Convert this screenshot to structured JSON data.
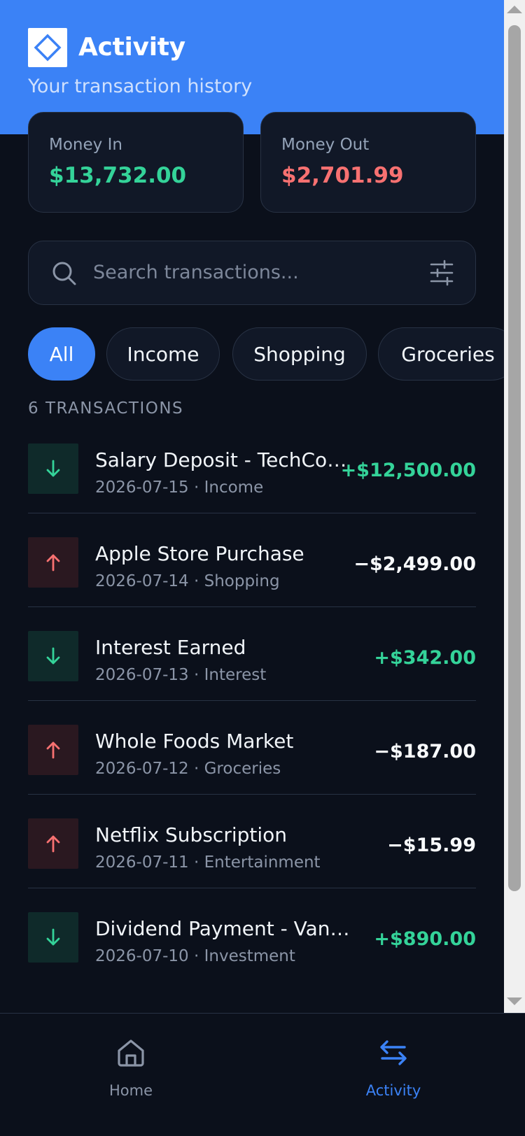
{
  "header": {
    "title": "Activity",
    "subtitle": "Your transaction history",
    "logo_icon": "diamond-logo-icon",
    "background": "#3b82f6"
  },
  "summary": {
    "money_in": {
      "label": "Money In",
      "value": "$13,732.00",
      "color": "#34d399"
    },
    "money_out": {
      "label": "Money Out",
      "value": "$2,701.99",
      "color": "#f87171"
    }
  },
  "search": {
    "placeholder": "Search transactions...",
    "value": "",
    "icon": "search-icon",
    "filter_icon": "sliders-icon"
  },
  "filters": [
    {
      "label": "All",
      "active": true
    },
    {
      "label": "Income",
      "active": false
    },
    {
      "label": "Shopping",
      "active": false
    },
    {
      "label": "Groceries",
      "active": false
    }
  ],
  "transactions_count": "6 TRANSACTIONS",
  "transactions": [
    {
      "name": "Salary Deposit - TechCorp Inc.",
      "meta": "2026-07-15 · Income",
      "amount": "+$12,500.00",
      "type": "credit",
      "icon": "arrow-down-icon"
    },
    {
      "name": "Apple Store Purchase",
      "meta": "2026-07-14 · Shopping",
      "amount": "−$2,499.00",
      "type": "debit",
      "icon": "arrow-up-icon"
    },
    {
      "name": "Interest Earned",
      "meta": "2026-07-13 · Interest",
      "amount": "+$342.00",
      "type": "credit",
      "icon": "arrow-down-icon"
    },
    {
      "name": "Whole Foods Market",
      "meta": "2026-07-12 · Groceries",
      "amount": "−$187.00",
      "type": "debit",
      "icon": "arrow-up-icon"
    },
    {
      "name": "Netflix Subscription",
      "meta": "2026-07-11 · Entertainment",
      "amount": "−$15.99",
      "type": "debit",
      "icon": "arrow-up-icon"
    },
    {
      "name": "Dividend Payment - Vanguard",
      "meta": "2026-07-10 · Investment",
      "amount": "+$890.00",
      "type": "credit",
      "icon": "arrow-down-icon"
    }
  ],
  "nav": {
    "home": {
      "label": "Home",
      "icon": "home-icon"
    },
    "activity": {
      "label": "Activity",
      "icon": "transfer-arrows-icon",
      "active": true
    }
  },
  "colors": {
    "accent": "#3b82f6",
    "credit": "#34d399",
    "debit_arrow": "#f87171",
    "background": "#0b101b",
    "card": "#111827"
  }
}
